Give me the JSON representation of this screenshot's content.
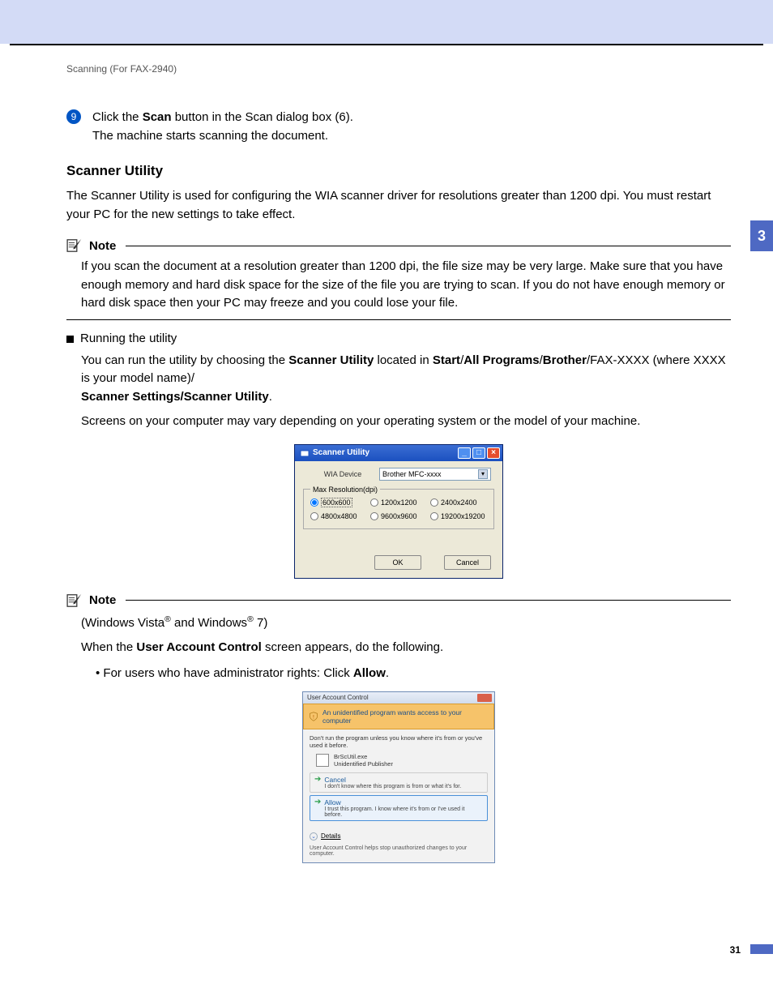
{
  "header": "Scanning (For FAX-2940)",
  "chapter_tab": "3",
  "page_number": "31",
  "step9": {
    "num": "9",
    "line1a": "Click the ",
    "line1b": "Scan",
    "line1c": " button in the Scan dialog box (6).",
    "line2": "The machine starts scanning the document."
  },
  "section_title": "Scanner Utility",
  "intro": "The Scanner Utility is used for configuring the WIA scanner driver for resolutions greater than 1200 dpi. You must restart your PC for the new settings to take effect.",
  "note1": {
    "label": "Note",
    "body": "If you scan the document at a resolution greater than 1200 dpi, the file size may be very large. Make sure that you have enough memory and hard disk space for the size of the file you are trying to scan. If you do not have enough memory or hard disk space then your PC may freeze and you could lose your file."
  },
  "running_title": "Running the utility",
  "running_p1": {
    "a": "You can run the utility by choosing the ",
    "b": "Scanner Utility",
    "c": " located in ",
    "d": "Start",
    "e": "All Programs",
    "f": "Brother",
    "g": "/FAX-XXXX (where XXXX is your model name)/"
  },
  "running_p1_line3": "Scanner Settings/Scanner Utility",
  "running_p2": "Screens on your computer may vary depending on your operating system or the model of your machine.",
  "scanner_dlg": {
    "title": "Scanner Utility",
    "device_label": "WIA Device",
    "device_value": "Brother MFC-xxxx",
    "fieldset": "Max Resolution(dpi)",
    "options": [
      "600x600",
      "1200x1200",
      "2400x2400",
      "4800x4800",
      "9600x9600",
      "19200x19200"
    ],
    "ok": "OK",
    "cancel": "Cancel"
  },
  "note2": {
    "label": "Note",
    "os_a": "(Windows Vista",
    "os_b": " and Windows",
    "os_c": " 7)",
    "p1a": "When the ",
    "p1b": "User Account Control",
    "p1c": " screen appears, do the following.",
    "bullet_a": "For users who have administrator rights: Click ",
    "bullet_b": "Allow",
    "bullet_c": "."
  },
  "uac": {
    "title": "User Account Control",
    "banner": "An unidentified program wants access to your computer",
    "warn": "Don't run the program unless you know where it's from or you've used it before.",
    "prog_name": "BrScUtil.exe",
    "prog_pub": "Unidentified Publisher",
    "cancel_title": "Cancel",
    "cancel_desc": "I don't know where this program is from or what it's for.",
    "allow_title": "Allow",
    "allow_desc": "I trust this program. I know where it's from or I've used it before.",
    "details": "Details",
    "footer": "User Account Control helps stop unauthorized changes to your computer."
  }
}
